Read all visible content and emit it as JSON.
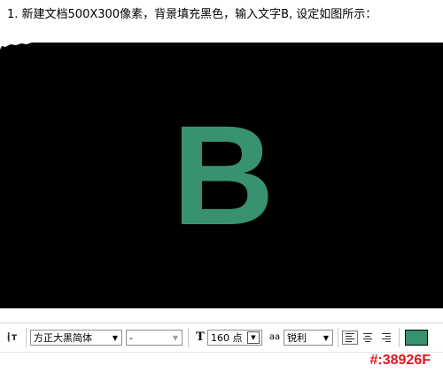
{
  "instruction": {
    "text": "1. 新建文档500X300像素，背景填充黑色，输入文字B, 设定如图所示："
  },
  "canvas": {
    "background": "#000000",
    "text": "B",
    "text_color": "#38926F"
  },
  "toolbar": {
    "tool_icon": "text-orientation-icon",
    "font_family": "方正大黑简体",
    "font_style": "-",
    "size_icon": "font-size-icon",
    "font_size": "160 点",
    "antialias_icon": "antialias-icon",
    "antialias_label": "aa",
    "antialias": "锐利",
    "align_left_icon": "align-left-icon",
    "align_center_icon": "align-center-icon",
    "align_right_icon": "align-right-icon",
    "active_alignment": "left",
    "color_swatch": "#38926F"
  },
  "caption": {
    "color_code": "#:38926F",
    "color": "#e8131a"
  }
}
